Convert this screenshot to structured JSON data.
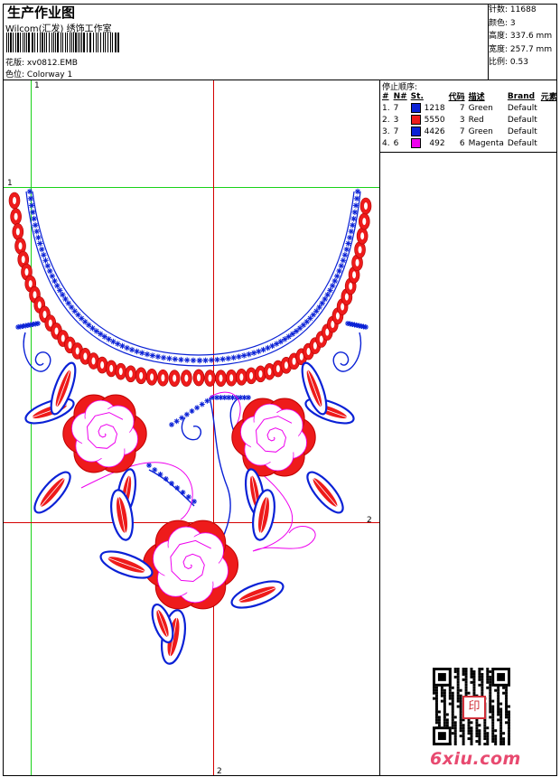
{
  "header": {
    "title": "生产作业图",
    "company": "Wilcom(汇发) 绣饰工作室",
    "design_label": "花版:",
    "design_value": "xv0812.EMB",
    "colorway_label": "色位:",
    "colorway_value": "Colorway 1"
  },
  "stats": {
    "stitches_label": "针数:",
    "stitches_value": "11688",
    "colors_label": "颜色:",
    "colors_value": "3",
    "height_label": "高度:",
    "height_value": "337.6 mm",
    "width_label": "宽度:",
    "width_value": "257.7 mm",
    "scale_label": "比例:",
    "scale_value": "0.53"
  },
  "stop_sequence": {
    "title": "停止顺序:",
    "columns": [
      "#",
      "N#",
      "St.",
      "代码",
      "描述",
      "Brand",
      "元素"
    ],
    "rows": [
      {
        "idx": "1.",
        "n": "7",
        "color": "#0a21d6",
        "stitches": "1218",
        "code": "7",
        "desc": "Green",
        "brand": "Default"
      },
      {
        "idx": "2.",
        "n": "3",
        "color": "#ee1b1b",
        "stitches": "5550",
        "code": "3",
        "desc": "Red",
        "brand": "Default"
      },
      {
        "idx": "3.",
        "n": "7",
        "color": "#0a21d6",
        "stitches": "4426",
        "code": "7",
        "desc": "Green",
        "brand": "Default"
      },
      {
        "idx": "4.",
        "n": "6",
        "color": "#ee00ee",
        "stitches": "492",
        "code": "6",
        "desc": "Magenta",
        "brand": "Default"
      }
    ]
  },
  "guides": {
    "v1": "1",
    "h1": "1",
    "h2": "2",
    "v2": "2"
  },
  "watermark": {
    "site": "6xiu.com",
    "seal": "印"
  },
  "colors": {
    "blue": "#0a21d6",
    "red": "#ee1b1b",
    "magenta": "#ee00ee",
    "guide_green": "#19d219",
    "guide_red": "#d40000"
  }
}
